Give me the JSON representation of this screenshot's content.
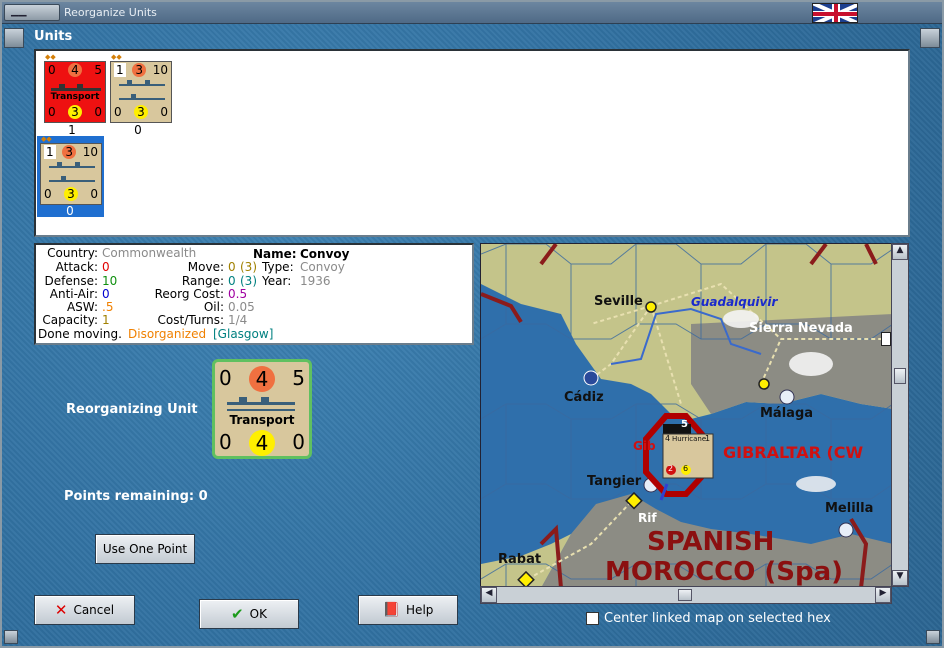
{
  "window": {
    "title": "Reorganize Units"
  },
  "units": {
    "label": "Units",
    "cards": [
      {
        "attack": "0",
        "move": "4",
        "defense": "5",
        "type_label": "Transport",
        "aa": "0",
        "center": "3",
        "asw": "0",
        "count": "1",
        "bg": "#ee1111"
      },
      {
        "attack": "1",
        "move": "3",
        "defense": "10",
        "type_label": "",
        "aa": "0",
        "center": "3",
        "asw": "0",
        "count": "0",
        "bg": "#d8c79d"
      },
      {
        "attack": "1",
        "move": "3",
        "defense": "10",
        "type_label": "",
        "aa": "0",
        "center": "3",
        "asw": "0",
        "count": "0",
        "bg": "#d8c79d"
      }
    ]
  },
  "info": {
    "country_label": "Country:",
    "country": "Commonwealth",
    "attack_label": "Attack:",
    "attack": "0",
    "defense_label": "Defense:",
    "defense": "10",
    "aa_label": "Anti-Air:",
    "aa": "0",
    "asw_label": "ASW:",
    "asw": ".5",
    "capacity_label": "Capacity:",
    "capacity": "1",
    "done_moving": "Done moving.",
    "disorganized": "Disorganized",
    "location": "[Glasgow]",
    "name_label": "Name:",
    "name": "Convoy",
    "move_label": "Move:",
    "move": "0",
    "move_paren": "(3)",
    "type_label": "Type:",
    "type": "Convoy",
    "range_label": "Range:",
    "range": "0",
    "range_paren": "(3)",
    "year_label": "Year:",
    "year": "1936",
    "reorg_label": "Reorg Cost:",
    "reorg_cost": "0.5",
    "oil_label": "Oil:",
    "oil": "0.05",
    "cost_label": "Cost/Turns:",
    "cost_turns": "1/4"
  },
  "reorganizing": {
    "label": "Reorganizing Unit",
    "attack": "0",
    "move": "4",
    "defense": "5",
    "type_label": "Transport",
    "aa": "0",
    "center": "4",
    "asw": "0"
  },
  "points": {
    "label": "Points remaining:",
    "value": "0"
  },
  "buttons": {
    "use_point": "Use One Point",
    "cancel": "Cancel",
    "ok": "OK",
    "help": "Help"
  },
  "map": {
    "labels": {
      "seville": "Seville",
      "guadalquivir": "Guadalquivir",
      "sierra": "Sierra Nevada",
      "cadiz": "Cádiz",
      "malaga": "Málaga",
      "gib": "Gib",
      "gibraltar": "GIBRALTAR (CW",
      "tangier": "Tangier",
      "rif": "Rif",
      "melilla": "Melilla",
      "rabat": "Rabat",
      "spanish": "SPANISH",
      "morocco": "MOROCCO (Spa)"
    },
    "stack": {
      "count": "5",
      "unit_name": "Hurricane",
      "unit_top_left": "4",
      "unit_top_right": "1",
      "unit_bottom_left": "2",
      "unit_bottom_right": "6"
    },
    "center_linked_label": "Center linked map on selected hex"
  },
  "colors": {
    "sea": "#2f6fab",
    "land": "#c4c48a",
    "mountain": "#8c8c84",
    "border": "#8b1b1b",
    "accent_red": "#d01010"
  }
}
